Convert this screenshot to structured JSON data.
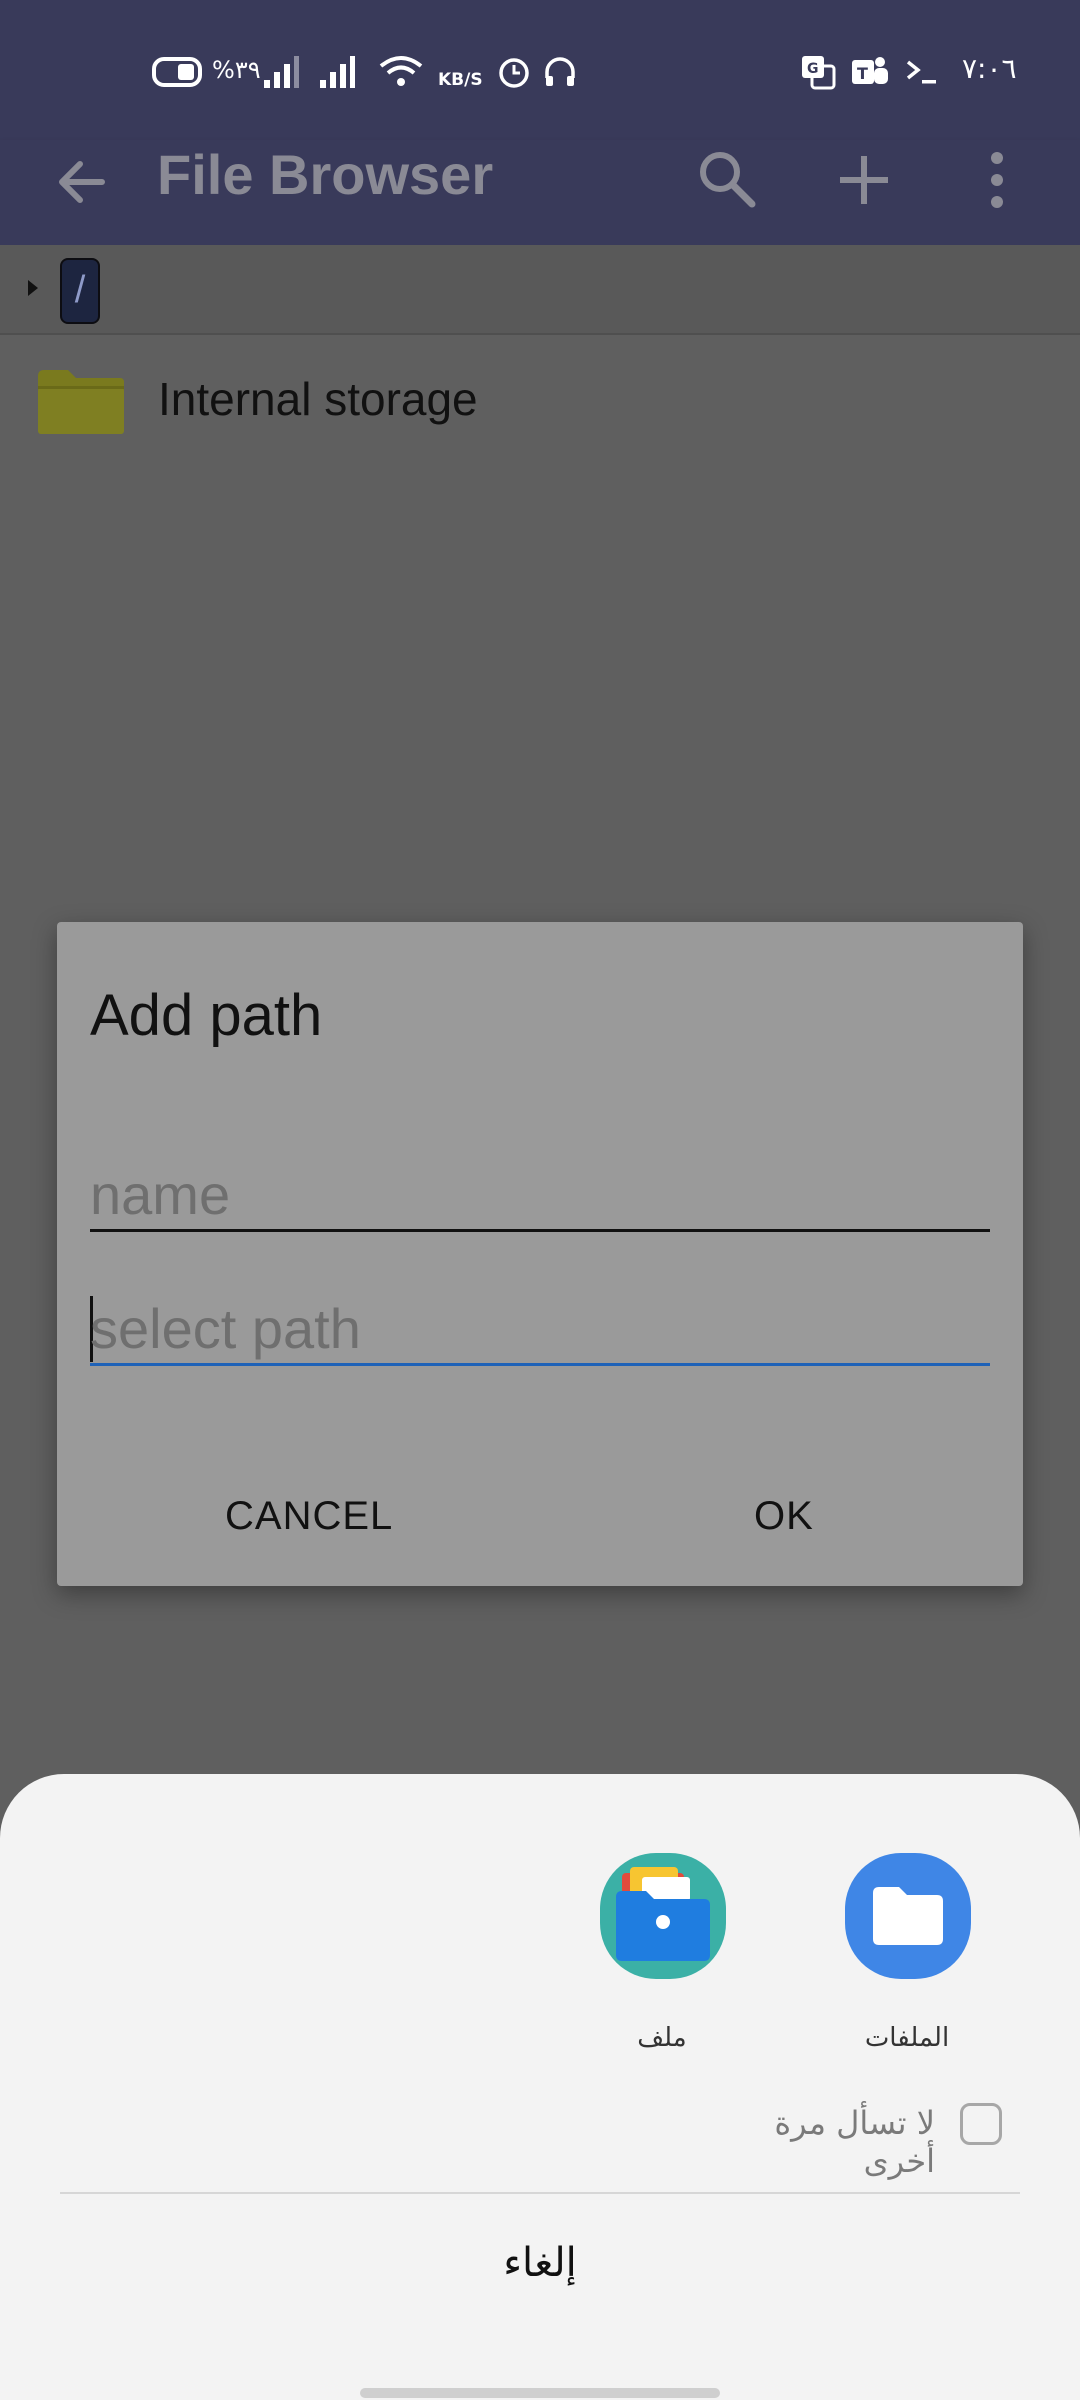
{
  "status_bar": {
    "battery_percent": "%٣٩",
    "net_speed_unit": "KB/S",
    "time": "٧:٠٦",
    "icons": [
      "battery-icon",
      "signal-icon",
      "signal-icon",
      "wifi-icon",
      "alarm-icon",
      "headset-icon",
      "translate-icon",
      "teams-icon",
      "terminal-icon"
    ]
  },
  "app_bar": {
    "title": "File Browser",
    "icons": [
      "back-arrow-icon",
      "search-icon",
      "add-icon",
      "more-vert-icon"
    ]
  },
  "breadcrumb": {
    "root": "/"
  },
  "file_list": [
    {
      "name": "Internal storage",
      "icon": "folder-icon"
    }
  ],
  "dialog": {
    "title": "Add path",
    "name_placeholder": "name",
    "path_placeholder": "select path",
    "cancel_label": "CANCEL",
    "ok_label": "OK"
  },
  "chooser": {
    "apps": [
      {
        "label": "الملفات",
        "icon": "files-app-icon"
      },
      {
        "label": "ملف",
        "icon": "file-manager-icon"
      }
    ],
    "dont_ask_label": "لا تسأل مرة أخرى",
    "cancel_label": "إلغاء"
  },
  "colors": {
    "app_bar": "#393a5a",
    "dim_background": "#5f5f5f",
    "dialog_bg": "#9a9a9a",
    "sheet_bg": "#f3f3f3",
    "accent_underline": "#1e62b8",
    "files_app_blue": "#3f86e6",
    "folder_olive": "#7a7a1e"
  }
}
